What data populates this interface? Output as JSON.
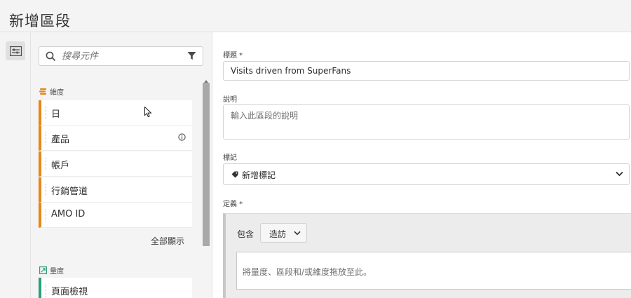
{
  "page": {
    "title": "新增區段"
  },
  "left_panel": {
    "search": {
      "placeholder": "搜尋元件"
    },
    "dimensions": {
      "heading": "維度",
      "items": [
        {
          "label": "日"
        },
        {
          "label": "產品"
        },
        {
          "label": "帳戶"
        },
        {
          "label": "行銷管道"
        },
        {
          "label": "AMO ID"
        }
      ],
      "show_all": "全部顯示"
    },
    "metrics": {
      "heading": "量度",
      "items": [
        {
          "label": "頁面檢視"
        }
      ]
    }
  },
  "form": {
    "title": {
      "label": "標題 *",
      "value": "Visits driven from SuperFans"
    },
    "description": {
      "label": "說明",
      "placeholder": "輸入此區段的說明"
    },
    "tags": {
      "label": "標記",
      "placeholder": "新增標記"
    },
    "definition": {
      "label": "定義 *",
      "include_label": "包含",
      "scope": "造訪",
      "dropzone_text": "將量度、區段和/或維度拖放至此。"
    }
  },
  "colors": {
    "dimension_accent": "#e68619",
    "metric_accent": "#2d9d78"
  }
}
